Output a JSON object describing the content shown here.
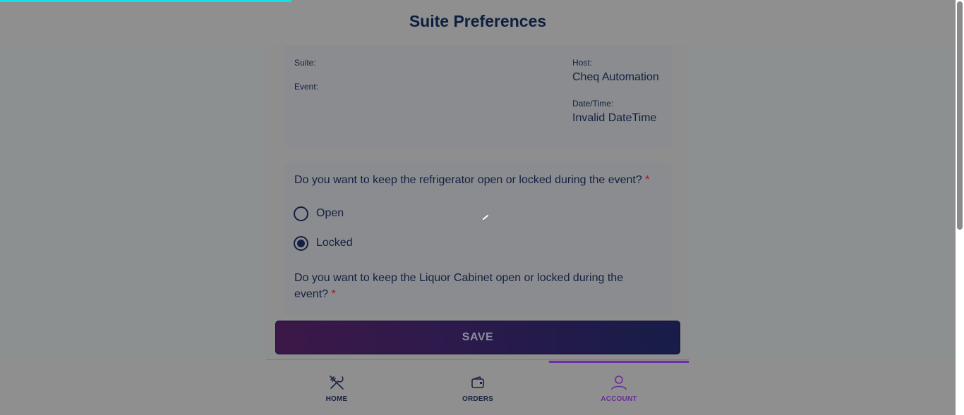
{
  "header": {
    "title": "Suite Preferences"
  },
  "info": {
    "suite_label": "Suite:",
    "event_label": "Event:",
    "host_label": "Host:",
    "host_value": "Cheq Automation",
    "datetime_label": "Date/Time:",
    "datetime_value": "Invalid DateTime"
  },
  "questions": [
    {
      "text": "Do you want to keep the refrigerator open or locked during the event?",
      "required_mark": "*",
      "options": [
        {
          "label": "Open",
          "selected": false
        },
        {
          "label": "Locked",
          "selected": true
        }
      ]
    },
    {
      "text": "Do you want to keep the Liquor Cabinet open or locked during the event?",
      "required_mark": "*"
    }
  ],
  "save_label": "SAVE",
  "nav": {
    "items": [
      {
        "label": "HOME",
        "icon": "utensils-icon"
      },
      {
        "label": "ORDERS",
        "icon": "wallet-icon"
      },
      {
        "label": "ACCOUNT",
        "icon": "user-icon",
        "active": true
      }
    ]
  },
  "colors": {
    "accent": "#6e2fa6",
    "progress": "#14e0e6",
    "required": "#b0101a",
    "text": "#152040"
  }
}
